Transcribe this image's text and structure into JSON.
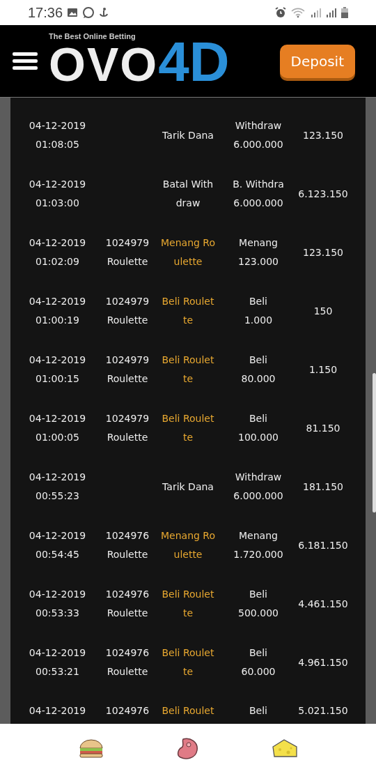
{
  "status_bar": {
    "time": "17:36"
  },
  "header": {
    "logo_tagline": "The Best Online Betting",
    "logo_main": "OVO",
    "logo_accent": "4D",
    "deposit_button": "Deposit"
  },
  "rows": [
    {
      "date": "04-12-2019",
      "time": "01:08:05",
      "id": [],
      "description": [
        "Tarik Dana"
      ],
      "game": false,
      "amount": [
        "Withdraw",
        "6.000.000"
      ],
      "balance": "123.150"
    },
    {
      "date": "04-12-2019",
      "time": "01:03:00",
      "id": [],
      "description": [
        "Batal With",
        "draw"
      ],
      "game": false,
      "amount": [
        "B. Withdra",
        "6.000.000"
      ],
      "balance": "6.123.150"
    },
    {
      "date": "04-12-2019",
      "time": "01:02:09",
      "id": [
        "1024979",
        "Roulette"
      ],
      "description": [
        "Menang Ro",
        "ulette"
      ],
      "game": true,
      "amount": [
        "Menang",
        "123.000"
      ],
      "balance": "123.150"
    },
    {
      "date": "04-12-2019",
      "time": "01:00:19",
      "id": [
        "1024979",
        "Roulette"
      ],
      "description": [
        "Beli Roulet",
        "te"
      ],
      "game": true,
      "amount": [
        "Beli",
        "1.000"
      ],
      "balance": "150"
    },
    {
      "date": "04-12-2019",
      "time": "01:00:15",
      "id": [
        "1024979",
        "Roulette"
      ],
      "description": [
        "Beli Roulet",
        "te"
      ],
      "game": true,
      "amount": [
        "Beli",
        "80.000"
      ],
      "balance": "1.150"
    },
    {
      "date": "04-12-2019",
      "time": "01:00:05",
      "id": [
        "1024979",
        "Roulette"
      ],
      "description": [
        "Beli Roulet",
        "te"
      ],
      "game": true,
      "amount": [
        "Beli",
        "100.000"
      ],
      "balance": "81.150"
    },
    {
      "date": "04-12-2019",
      "time": "00:55:23",
      "id": [],
      "description": [
        "Tarik Dana"
      ],
      "game": false,
      "amount": [
        "Withdraw",
        "6.000.000"
      ],
      "balance": "181.150"
    },
    {
      "date": "04-12-2019",
      "time": "00:54:45",
      "id": [
        "1024976",
        "Roulette"
      ],
      "description": [
        "Menang Ro",
        "ulette"
      ],
      "game": true,
      "amount": [
        "Menang",
        "1.720.000"
      ],
      "balance": "6.181.150"
    },
    {
      "date": "04-12-2019",
      "time": "00:53:33",
      "id": [
        "1024976",
        "Roulette"
      ],
      "description": [
        "Beli Roulet",
        "te"
      ],
      "game": true,
      "amount": [
        "Beli",
        "500.000"
      ],
      "balance": "4.461.150"
    },
    {
      "date": "04-12-2019",
      "time": "00:53:21",
      "id": [
        "1024976",
        "Roulette"
      ],
      "description": [
        "Beli Roulet",
        "te"
      ],
      "game": true,
      "amount": [
        "Beli",
        "60.000"
      ],
      "balance": "4.961.150"
    },
    {
      "date": "04-12-2019",
      "id": [
        "1024976"
      ],
      "description": [
        "Beli Roulet"
      ],
      "game": true,
      "amount": [
        "Beli"
      ],
      "balance": "5.021.150"
    }
  ]
}
